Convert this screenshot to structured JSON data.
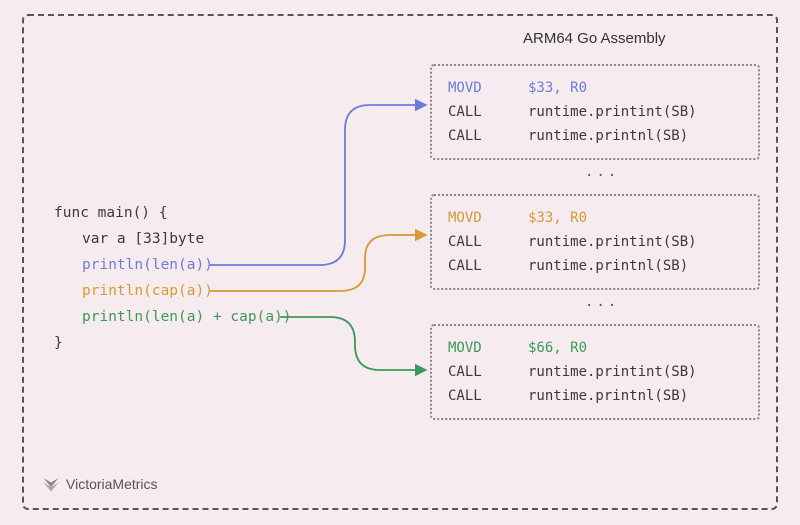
{
  "title": "ARM64 Go Assembly",
  "code": {
    "l1": "func main() {",
    "l2": "var a [33]byte",
    "l3": "println(len(a))",
    "l4": "println(cap(a))",
    "l5": "println(len(a) + cap(a))",
    "l6": "}"
  },
  "asm": {
    "box1": {
      "r1_op": "MOVD",
      "r1_arg": "$33, R0",
      "r2_op": "CALL",
      "r2_arg": "runtime.printint(SB)",
      "r3_op": "CALL",
      "r3_arg": "runtime.printnl(SB)"
    },
    "box2": {
      "r1_op": "MOVD",
      "r1_arg": "$33, R0",
      "r2_op": "CALL",
      "r2_arg": "runtime.printint(SB)",
      "r3_op": "CALL",
      "r3_arg": "runtime.printnl(SB)"
    },
    "box3": {
      "r1_op": "MOVD",
      "r1_arg": "$66, R0",
      "r2_op": "CALL",
      "r2_arg": "runtime.printint(SB)",
      "r3_op": "CALL",
      "r3_arg": "runtime.printnl(SB)"
    },
    "ellipsis": "..."
  },
  "colors": {
    "blue": "#6b7dd6",
    "orange": "#d79a34",
    "green": "#3a9a5a"
  },
  "attribution": "VictoriaMetrics"
}
